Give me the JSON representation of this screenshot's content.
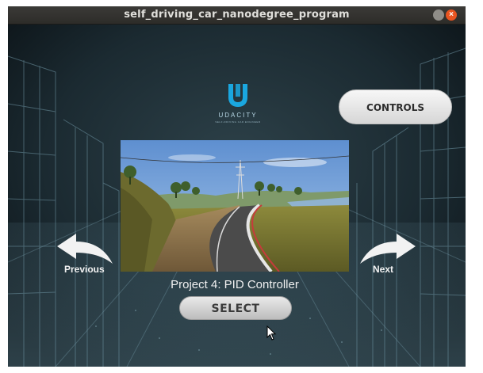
{
  "window": {
    "title": "self_driving_car_nanodegree_program"
  },
  "logo": {
    "brand": "UDACITY",
    "tagline": "SELF-DRIVING CAR ENGINEER"
  },
  "controls_button": {
    "label": "CONTROLS"
  },
  "project": {
    "title": "Project 4: PID Controller"
  },
  "navigation": {
    "previous_label": "Previous",
    "next_label": "Next"
  },
  "select_button": {
    "label": "SELECT"
  },
  "colors": {
    "logo_blue": "#1aa7e0",
    "close_button": "#e95420",
    "titlebar": "#2d2c29"
  },
  "icons": [
    "udacity-logo-icon",
    "previous-arrow-icon",
    "next-arrow-icon",
    "mouse-cursor-icon"
  ]
}
